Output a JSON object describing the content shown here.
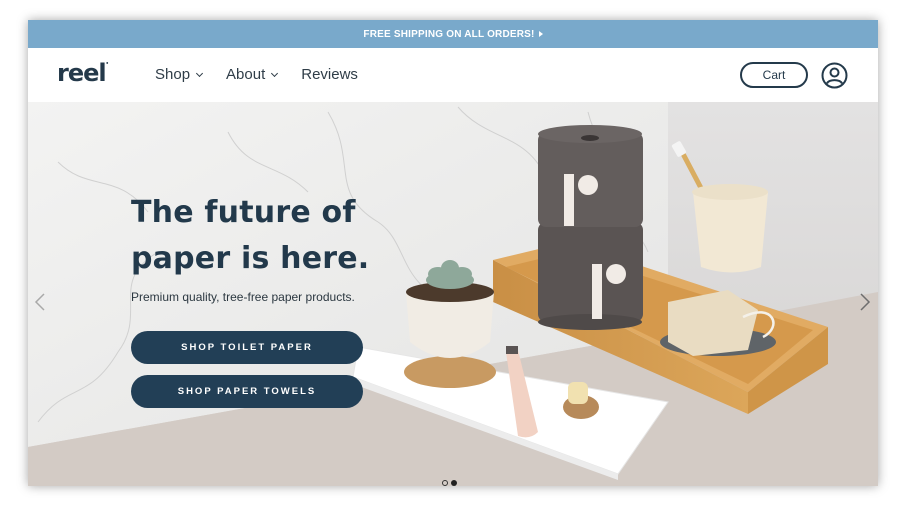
{
  "announcement": {
    "text": "FREE SHIPPING ON ALL ORDERS!",
    "icon": "caret-right-icon"
  },
  "nav": {
    "logo": "reel",
    "menu": [
      {
        "label": "Shop",
        "has_dropdown": true
      },
      {
        "label": "About",
        "has_dropdown": true
      },
      {
        "label": "Reviews",
        "has_dropdown": false
      }
    ],
    "cart_label": "Cart",
    "account_icon": "user-circle-icon"
  },
  "hero": {
    "headline_line1": "The future of",
    "headline_line2": "paper is here.",
    "subtitle": "Premium quality, tree-free paper products.",
    "buttons": [
      {
        "label": "SHOP TOILET PAPER"
      },
      {
        "label": "SHOP PAPER TOWELS"
      }
    ],
    "prev_icon": "chevron-left-icon",
    "next_icon": "chevron-right-icon",
    "slides_total": 2,
    "active_slide": 2,
    "image_alt": "Toilet paper rolls on bamboo tray with succulent, cup and toothbrush"
  },
  "colors": {
    "announcement_bg": "#79a9cb",
    "brand_navy": "#223f56",
    "text_dark": "#22394b"
  }
}
